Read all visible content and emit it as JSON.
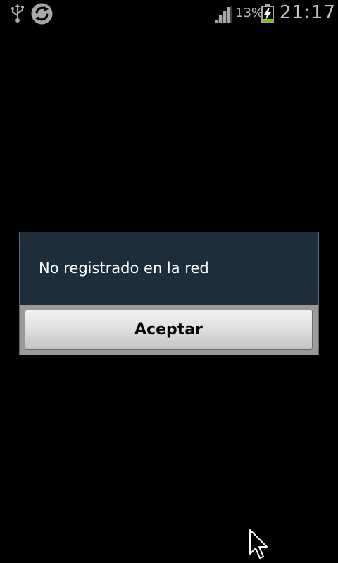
{
  "status_bar": {
    "battery_percent": "13%",
    "time": "21:17",
    "icons": [
      "usb-icon",
      "sync-icon",
      "signal-icon",
      "battery-charging-icon"
    ]
  },
  "dialog": {
    "message": "No registrado en la red",
    "accept_label": "Aceptar"
  },
  "colors": {
    "background": "#000000",
    "dialog_body": "#1e2d3a",
    "dialog_frame": "#9a9a9a",
    "battery_level": "#7cc400"
  }
}
